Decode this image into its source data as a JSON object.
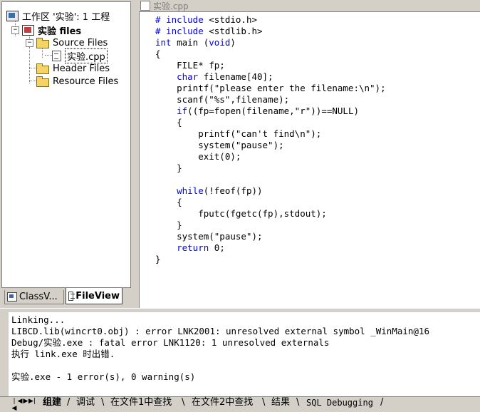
{
  "workspace": {
    "root": "工作区 '实验': 1 工程",
    "project": "实验 files",
    "source_folder": "Source Files",
    "source_file": "实验.cpp",
    "header_folder": "Header Files",
    "resource_folder": "Resource Files",
    "tabs": {
      "classview": "ClassV...",
      "fileview": "FileView"
    }
  },
  "editor": {
    "title": "实验.cpp",
    "code": [
      [
        {
          "t": "# include ",
          "k": 1
        },
        {
          "t": "<stdio.h>",
          "k": 0
        }
      ],
      [
        {
          "t": "# include ",
          "k": 1
        },
        {
          "t": "<stdlib.h>",
          "k": 0
        }
      ],
      [
        {
          "t": "int",
          "k": 1
        },
        {
          "t": " main (",
          "k": 0
        },
        {
          "t": "void",
          "k": 1
        },
        {
          "t": ")",
          "k": 0
        }
      ],
      [
        {
          "t": "{",
          "k": 0
        }
      ],
      [
        {
          "t": "    FILE* fp;",
          "k": 0
        }
      ],
      [
        {
          "t": "    ",
          "k": 0
        },
        {
          "t": "char",
          "k": 1
        },
        {
          "t": " filename[40];",
          "k": 0
        }
      ],
      [
        {
          "t": "    printf(\"please enter the filename:\\n\");",
          "k": 0
        }
      ],
      [
        {
          "t": "    scanf(\"%s\",filename);",
          "k": 0
        }
      ],
      [
        {
          "t": "    ",
          "k": 0
        },
        {
          "t": "if",
          "k": 1
        },
        {
          "t": "((fp=fopen(filename,\"r\"))==NULL)",
          "k": 0
        }
      ],
      [
        {
          "t": "    {",
          "k": 0
        }
      ],
      [
        {
          "t": "        printf(\"can't find\\n\");",
          "k": 0
        }
      ],
      [
        {
          "t": "        system(\"pause\");",
          "k": 0
        }
      ],
      [
        {
          "t": "        exit(0);",
          "k": 0
        }
      ],
      [
        {
          "t": "    }",
          "k": 0
        }
      ],
      [
        {
          "t": "",
          "k": 0
        }
      ],
      [
        {
          "t": "    ",
          "k": 0
        },
        {
          "t": "while",
          "k": 1
        },
        {
          "t": "(!feof(fp))",
          "k": 0
        }
      ],
      [
        {
          "t": "    {",
          "k": 0
        }
      ],
      [
        {
          "t": "        fputc(fgetc(fp),stdout);",
          "k": 0
        }
      ],
      [
        {
          "t": "    }",
          "k": 0
        }
      ],
      [
        {
          "t": "    system(\"pause\");",
          "k": 0
        }
      ],
      [
        {
          "t": "    ",
          "k": 0
        },
        {
          "t": "return",
          "k": 1
        },
        {
          "t": " 0;",
          "k": 0
        }
      ],
      [
        {
          "t": "}",
          "k": 0
        }
      ]
    ]
  },
  "output": {
    "lines": [
      "Linking...",
      "LIBCD.lib(wincrt0.obj) : error LNK2001: unresolved external symbol _WinMain@16",
      "Debug/实验.exe : fatal error LNK1120: 1 unresolved externals",
      "执行 link.exe 时出错.",
      "",
      "实验.exe - 1 error(s), 0 warning(s)"
    ],
    "tabs": [
      "组建",
      "调试",
      "在文件1中查找",
      "在文件2中查找",
      "结果",
      "SQL Debugging"
    ]
  },
  "colors": {
    "keyword": "#0000ff",
    "chrome": "#d4d0c8"
  }
}
